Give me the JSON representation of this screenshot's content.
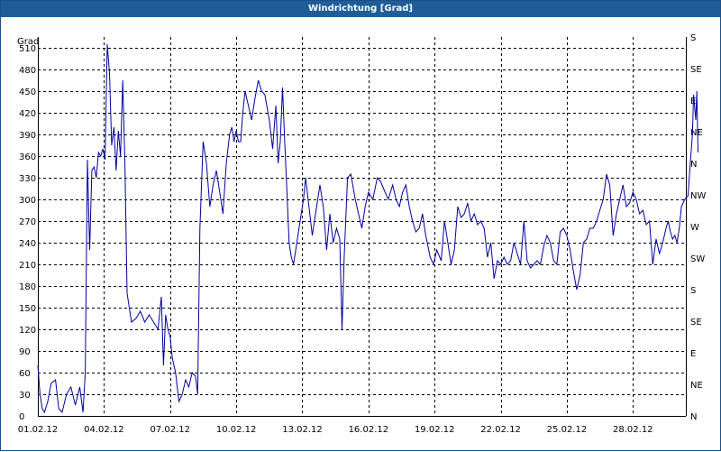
{
  "window": {
    "title": "Windrichtung [Grad]"
  },
  "chart_data": {
    "type": "line",
    "title": "Windrichtung [Grad]",
    "ylabel": "Grad",
    "ylim": [
      0,
      525
    ],
    "y_ticks": [
      0,
      30,
      60,
      90,
      120,
      150,
      180,
      210,
      240,
      270,
      300,
      330,
      360,
      390,
      420,
      450,
      480,
      510
    ],
    "right_axis_labels": [
      "N",
      "NE",
      "E",
      "SE",
      "S",
      "SW",
      "W",
      "NW",
      "N",
      "NE",
      "E",
      "SE",
      "S"
    ],
    "right_axis_values": [
      0,
      45,
      90,
      135,
      180,
      225,
      270,
      315,
      360,
      405,
      450,
      495,
      540
    ],
    "x_tick_labels": [
      "01.02.12",
      "04.02.12",
      "07.02.12",
      "10.02.12",
      "13.02.12",
      "16.02.12",
      "19.02.12",
      "22.02.12",
      "25.02.12",
      "28.02.12"
    ],
    "x_tick_days": [
      0,
      3,
      6,
      9,
      12,
      15,
      18,
      21,
      24,
      27
    ],
    "x_range_days": [
      0,
      29.4
    ],
    "grid": true,
    "series": [
      {
        "color": "#0000a0",
        "points": [
          [
            0.0,
            70
          ],
          [
            0.1,
            30
          ],
          [
            0.2,
            10
          ],
          [
            0.3,
            5
          ],
          [
            0.45,
            20
          ],
          [
            0.6,
            45
          ],
          [
            0.8,
            50
          ],
          [
            0.95,
            10
          ],
          [
            1.1,
            5
          ],
          [
            1.3,
            30
          ],
          [
            1.5,
            40
          ],
          [
            1.7,
            15
          ],
          [
            1.9,
            40
          ],
          [
            2.05,
            5
          ],
          [
            2.15,
            60
          ],
          [
            2.25,
            355
          ],
          [
            2.35,
            230
          ],
          [
            2.45,
            340
          ],
          [
            2.55,
            345
          ],
          [
            2.65,
            330
          ],
          [
            2.75,
            365
          ],
          [
            2.85,
            360
          ],
          [
            2.95,
            370
          ],
          [
            3.05,
            355
          ],
          [
            3.15,
            515
          ],
          [
            3.25,
            475
          ],
          [
            3.35,
            375
          ],
          [
            3.45,
            400
          ],
          [
            3.55,
            340
          ],
          [
            3.65,
            395
          ],
          [
            3.75,
            360
          ],
          [
            3.85,
            465
          ],
          [
            3.95,
            350
          ],
          [
            4.05,
            170
          ],
          [
            4.25,
            130
          ],
          [
            4.45,
            135
          ],
          [
            4.65,
            145
          ],
          [
            4.85,
            130
          ],
          [
            5.05,
            140
          ],
          [
            5.25,
            130
          ],
          [
            5.45,
            120
          ],
          [
            5.6,
            165
          ],
          [
            5.7,
            70
          ],
          [
            5.8,
            140
          ],
          [
            5.9,
            120
          ],
          [
            6.0,
            110
          ],
          [
            6.1,
            80
          ],
          [
            6.25,
            60
          ],
          [
            6.4,
            20
          ],
          [
            6.55,
            30
          ],
          [
            6.7,
            50
          ],
          [
            6.85,
            40
          ],
          [
            7.0,
            60
          ],
          [
            7.15,
            55
          ],
          [
            7.25,
            30
          ],
          [
            7.35,
            260
          ],
          [
            7.5,
            380
          ],
          [
            7.65,
            350
          ],
          [
            7.8,
            290
          ],
          [
            7.95,
            320
          ],
          [
            8.1,
            340
          ],
          [
            8.25,
            310
          ],
          [
            8.4,
            280
          ],
          [
            8.55,
            350
          ],
          [
            8.7,
            390
          ],
          [
            8.8,
            400
          ],
          [
            8.9,
            380
          ],
          [
            9.0,
            395
          ],
          [
            9.1,
            380
          ],
          [
            9.2,
            380
          ],
          [
            9.3,
            420
          ],
          [
            9.4,
            450
          ],
          [
            9.55,
            430
          ],
          [
            9.7,
            410
          ],
          [
            9.85,
            440
          ],
          [
            10.0,
            465
          ],
          [
            10.15,
            450
          ],
          [
            10.3,
            445
          ],
          [
            10.5,
            410
          ],
          [
            10.65,
            370
          ],
          [
            10.8,
            430
          ],
          [
            10.9,
            350
          ],
          [
            11.0,
            380
          ],
          [
            11.1,
            455
          ],
          [
            11.2,
            380
          ],
          [
            11.3,
            310
          ],
          [
            11.4,
            240
          ],
          [
            11.5,
            220
          ],
          [
            11.6,
            210
          ],
          [
            11.75,
            240
          ],
          [
            11.9,
            270
          ],
          [
            12.05,
            300
          ],
          [
            12.15,
            330
          ],
          [
            12.3,
            290
          ],
          [
            12.45,
            250
          ],
          [
            12.6,
            280
          ],
          [
            12.8,
            320
          ],
          [
            12.95,
            290
          ],
          [
            13.1,
            230
          ],
          [
            13.25,
            280
          ],
          [
            13.4,
            240
          ],
          [
            13.55,
            260
          ],
          [
            13.7,
            245
          ],
          [
            13.8,
            120
          ],
          [
            13.9,
            220
          ],
          [
            14.05,
            330
          ],
          [
            14.2,
            335
          ],
          [
            14.4,
            300
          ],
          [
            14.55,
            280
          ],
          [
            14.7,
            260
          ],
          [
            14.85,
            290
          ],
          [
            15.0,
            310
          ],
          [
            15.2,
            300
          ],
          [
            15.4,
            330
          ],
          [
            15.55,
            325
          ],
          [
            15.75,
            310
          ],
          [
            15.9,
            300
          ],
          [
            16.1,
            320
          ],
          [
            16.25,
            300
          ],
          [
            16.4,
            290
          ],
          [
            16.55,
            310
          ],
          [
            16.7,
            320
          ],
          [
            16.85,
            290
          ],
          [
            17.0,
            270
          ],
          [
            17.15,
            255
          ],
          [
            17.3,
            260
          ],
          [
            17.45,
            280
          ],
          [
            17.6,
            250
          ],
          [
            17.8,
            220
          ],
          [
            17.95,
            210
          ],
          [
            18.1,
            230
          ],
          [
            18.3,
            215
          ],
          [
            18.45,
            270
          ],
          [
            18.6,
            240
          ],
          [
            18.75,
            210
          ],
          [
            18.9,
            230
          ],
          [
            19.05,
            290
          ],
          [
            19.2,
            275
          ],
          [
            19.35,
            280
          ],
          [
            19.5,
            295
          ],
          [
            19.65,
            270
          ],
          [
            19.8,
            280
          ],
          [
            19.95,
            265
          ],
          [
            20.1,
            270
          ],
          [
            20.25,
            260
          ],
          [
            20.4,
            220
          ],
          [
            20.55,
            240
          ],
          [
            20.7,
            190
          ],
          [
            20.85,
            215
          ],
          [
            21.0,
            210
          ],
          [
            21.15,
            220
          ],
          [
            21.3,
            210
          ],
          [
            21.45,
            215
          ],
          [
            21.6,
            240
          ],
          [
            21.75,
            225
          ],
          [
            21.9,
            210
          ],
          [
            22.05,
            270
          ],
          [
            22.2,
            215
          ],
          [
            22.35,
            205
          ],
          [
            22.5,
            210
          ],
          [
            22.65,
            215
          ],
          [
            22.8,
            210
          ],
          [
            22.95,
            235
          ],
          [
            23.1,
            250
          ],
          [
            23.25,
            240
          ],
          [
            23.4,
            215
          ],
          [
            23.55,
            210
          ],
          [
            23.7,
            255
          ],
          [
            23.85,
            260
          ],
          [
            24.0,
            250
          ],
          [
            24.15,
            230
          ],
          [
            24.3,
            200
          ],
          [
            24.45,
            175
          ],
          [
            24.6,
            195
          ],
          [
            24.75,
            240
          ],
          [
            24.9,
            245
          ],
          [
            25.05,
            260
          ],
          [
            25.2,
            260
          ],
          [
            25.35,
            270
          ],
          [
            25.5,
            285
          ],
          [
            25.65,
            300
          ],
          [
            25.8,
            335
          ],
          [
            25.95,
            320
          ],
          [
            26.1,
            250
          ],
          [
            26.25,
            280
          ],
          [
            26.4,
            300
          ],
          [
            26.55,
            320
          ],
          [
            26.7,
            290
          ],
          [
            26.85,
            295
          ],
          [
            27.0,
            310
          ],
          [
            27.15,
            300
          ],
          [
            27.3,
            280
          ],
          [
            27.45,
            285
          ],
          [
            27.6,
            265
          ],
          [
            27.75,
            270
          ],
          [
            27.9,
            210
          ],
          [
            28.05,
            245
          ],
          [
            28.2,
            225
          ],
          [
            28.35,
            240
          ],
          [
            28.5,
            260
          ],
          [
            28.6,
            270
          ],
          [
            28.7,
            255
          ],
          [
            28.8,
            245
          ],
          [
            28.9,
            250
          ],
          [
            29.0,
            240
          ],
          [
            29.1,
            260
          ],
          [
            29.2,
            290
          ],
          [
            29.35,
            300
          ],
          [
            29.5,
            305
          ],
          [
            29.6,
            350
          ],
          [
            29.7,
            390
          ],
          [
            29.75,
            445
          ],
          [
            29.85,
            410
          ],
          [
            29.9,
            450
          ],
          [
            29.95,
            365
          ]
        ]
      }
    ]
  }
}
